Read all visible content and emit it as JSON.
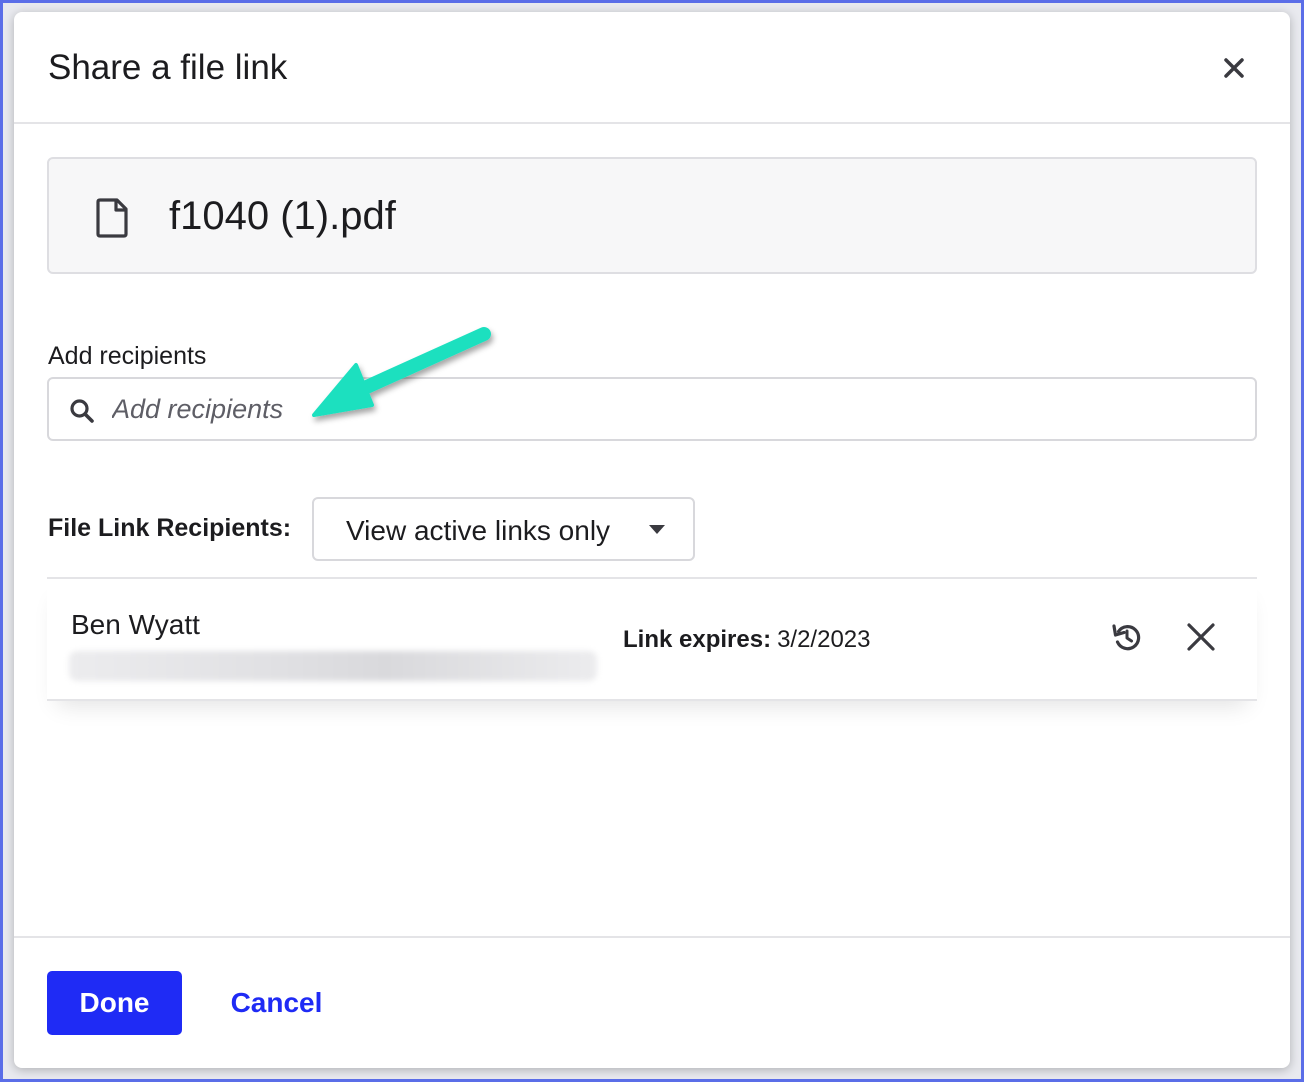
{
  "dialog": {
    "title": "Share a file link"
  },
  "file": {
    "name": "f1040 (1).pdf",
    "icon": "file-icon"
  },
  "recipients_input": {
    "label": "Add recipients",
    "placeholder": "Add recipients",
    "value": ""
  },
  "recipients_list": {
    "label": "File Link Recipients:",
    "filter_selected": "View active links only",
    "rows": [
      {
        "name": "Ben Wyatt",
        "expires_label": "Link expires:",
        "expires_value": "3/2/2023"
      }
    ]
  },
  "footer": {
    "done_label": "Done",
    "cancel_label": "Cancel"
  },
  "colors": {
    "primary": "#1f2bf5",
    "annotation_arrow": "#1de0bf",
    "frame": "#5b6ee8"
  }
}
